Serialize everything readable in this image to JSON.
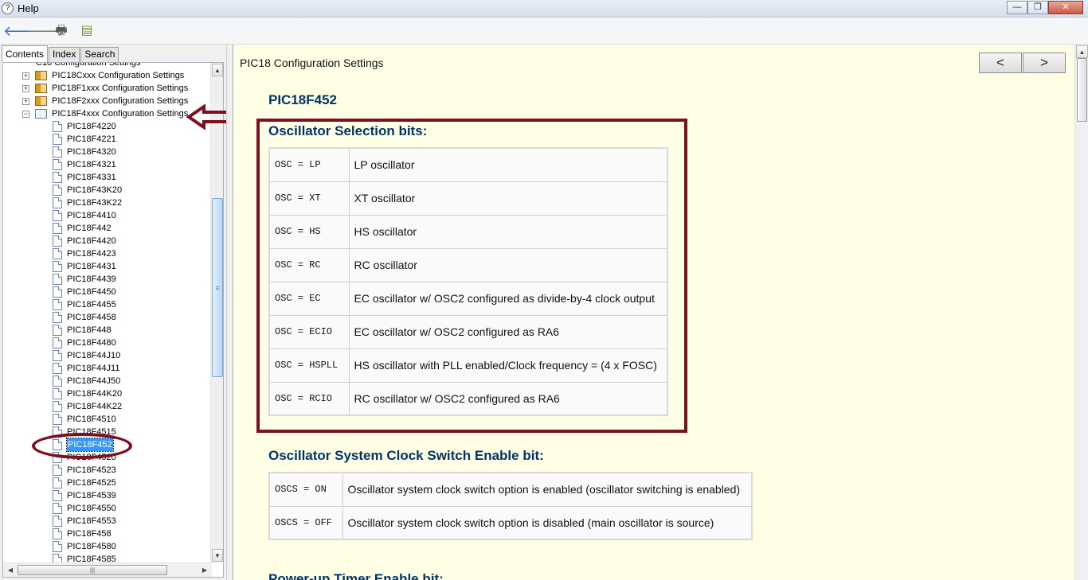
{
  "window": {
    "title": "Help",
    "app_icon": "help-question-icon",
    "buttons": {
      "minimize": "—",
      "maximize": "❐",
      "close": "✕"
    }
  },
  "toolbar": {
    "back_icon": "back-arrow-icon",
    "forward_icon": "forward-arrow-icon",
    "print_icon": "print-icon",
    "options_icon": "options-icon"
  },
  "nav": {
    "tabs": [
      {
        "label": "Contents",
        "active": true
      },
      {
        "label": "Index",
        "active": false
      },
      {
        "label": "Search",
        "active": false
      }
    ],
    "top_partial": "C18 Configuration Settings",
    "books": [
      {
        "label": "PIC18Cxxx Configuration Settings",
        "expander": "+"
      },
      {
        "label": "PIC18F1xxx Configuration Settings",
        "expander": "+"
      },
      {
        "label": "PIC18F2xxx Configuration Settings",
        "expander": "+"
      },
      {
        "label": "PIC18F4xxx Configuration Settings",
        "expander": "−"
      }
    ],
    "pages": [
      "PIC18F4220",
      "PIC18F4221",
      "PIC18F4320",
      "PIC18F4321",
      "PIC18F4331",
      "PIC18F43K20",
      "PIC18F43K22",
      "PIC18F4410",
      "PIC18F442",
      "PIC18F4420",
      "PIC18F4423",
      "PIC18F4431",
      "PIC18F4439",
      "PIC18F4450",
      "PIC18F4455",
      "PIC18F4458",
      "PIC18F448",
      "PIC18F4480",
      "PIC18F44J10",
      "PIC18F44J11",
      "PIC18F44J50",
      "PIC18F44K20",
      "PIC18F44K22",
      "PIC18F4510",
      "PIC18F4515",
      "PIC18F452",
      "PIC18F4520",
      "PIC18F4523",
      "PIC18F4525",
      "PIC18F4539",
      "PIC18F4550",
      "PIC18F4553",
      "PIC18F458",
      "PIC18F4580",
      "PIC18F4585"
    ],
    "selected": "PIC18F452"
  },
  "content": {
    "breadcrumb": "PIC18 Configuration Settings",
    "prev_label": "<",
    "next_label": ">",
    "device_title": "PIC18F452",
    "sections": [
      {
        "title": "Oscillator Selection bits:",
        "rows": [
          {
            "code": "OSC = LP",
            "desc": "LP oscillator"
          },
          {
            "code": "OSC = XT",
            "desc": "XT oscillator"
          },
          {
            "code": "OSC = HS",
            "desc": "HS oscillator"
          },
          {
            "code": "OSC = RC",
            "desc": "RC oscillator"
          },
          {
            "code": "OSC = EC",
            "desc": "EC oscillator w/ OSC2 configured as divide-by-4 clock output"
          },
          {
            "code": "OSC = ECIO",
            "desc": "EC oscillator w/ OSC2 configured as RA6"
          },
          {
            "code": "OSC = HSPLL",
            "desc": "HS oscillator with PLL enabled/Clock frequency = (4 x FOSC)"
          },
          {
            "code": "OSC = RCIO",
            "desc": "RC oscillator w/ OSC2 configured as RA6"
          }
        ]
      },
      {
        "title": "Oscillator System Clock Switch Enable bit:",
        "rows": [
          {
            "code": "OSCS = ON",
            "desc": "Oscillator system clock switch option is enabled (oscillator switching is enabled)"
          },
          {
            "code": "OSCS = OFF",
            "desc": "Oscillator system clock switch option is disabled (main oscillator is source)"
          }
        ]
      }
    ],
    "next_section_partial": "Power-up Timer Enable bit:"
  },
  "colors": {
    "content_bg": "#ffffe6",
    "heading": "#003366",
    "annotation": "#7a1020",
    "selection": "#3399ff"
  }
}
